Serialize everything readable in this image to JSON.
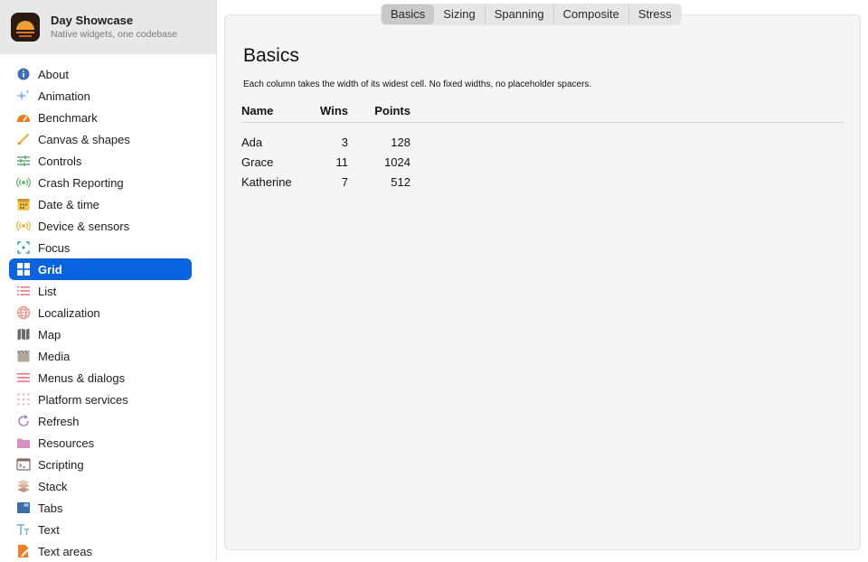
{
  "app": {
    "title": "Day Showcase",
    "subtitle": "Native widgets, one codebase"
  },
  "sidebar": {
    "selected_color": "#0a64e0",
    "items": [
      {
        "label": "About",
        "icon": "info-icon"
      },
      {
        "label": "Animation",
        "icon": "sparkles-icon"
      },
      {
        "label": "Benchmark",
        "icon": "speedometer-icon"
      },
      {
        "label": "Canvas & shapes",
        "icon": "brush-icon"
      },
      {
        "label": "Controls",
        "icon": "sliders-icon"
      },
      {
        "label": "Crash Reporting",
        "icon": "broadcast-icon"
      },
      {
        "label": "Date & time",
        "icon": "calendar-icon"
      },
      {
        "label": "Device & sensors",
        "icon": "sensor-icon"
      },
      {
        "label": "Focus",
        "icon": "focus-icon"
      },
      {
        "label": "Grid",
        "icon": "grid-icon",
        "selected": true
      },
      {
        "label": "List",
        "icon": "list-icon"
      },
      {
        "label": "Localization",
        "icon": "globe-icon"
      },
      {
        "label": "Map",
        "icon": "map-icon"
      },
      {
        "label": "Media",
        "icon": "clapperboard-icon"
      },
      {
        "label": "Menus & dialogs",
        "icon": "menu-icon"
      },
      {
        "label": "Platform services",
        "icon": "dots-grid-icon"
      },
      {
        "label": "Refresh",
        "icon": "refresh-icon"
      },
      {
        "label": "Resources",
        "icon": "folder-icon"
      },
      {
        "label": "Scripting",
        "icon": "terminal-icon"
      },
      {
        "label": "Stack",
        "icon": "layers-icon"
      },
      {
        "label": "Tabs",
        "icon": "tabs-icon"
      },
      {
        "label": "Text",
        "icon": "text-icon"
      },
      {
        "label": "Text areas",
        "icon": "document-edit-icon"
      }
    ]
  },
  "tabs": [
    {
      "label": "Basics",
      "active": true
    },
    {
      "label": "Sizing"
    },
    {
      "label": "Spanning"
    },
    {
      "label": "Composite"
    },
    {
      "label": "Stress"
    }
  ],
  "content": {
    "title": "Basics",
    "description": "Each column takes the width of its widest cell. No fixed widths, no placeholder spacers.",
    "table": {
      "headers": {
        "name": "Name",
        "wins": "Wins",
        "points": "Points"
      },
      "rows": [
        {
          "name": "Ada",
          "wins": "3",
          "points": "128"
        },
        {
          "name": "Grace",
          "wins": "11",
          "points": "1024"
        },
        {
          "name": "Katherine",
          "wins": "7",
          "points": "512"
        }
      ]
    }
  }
}
